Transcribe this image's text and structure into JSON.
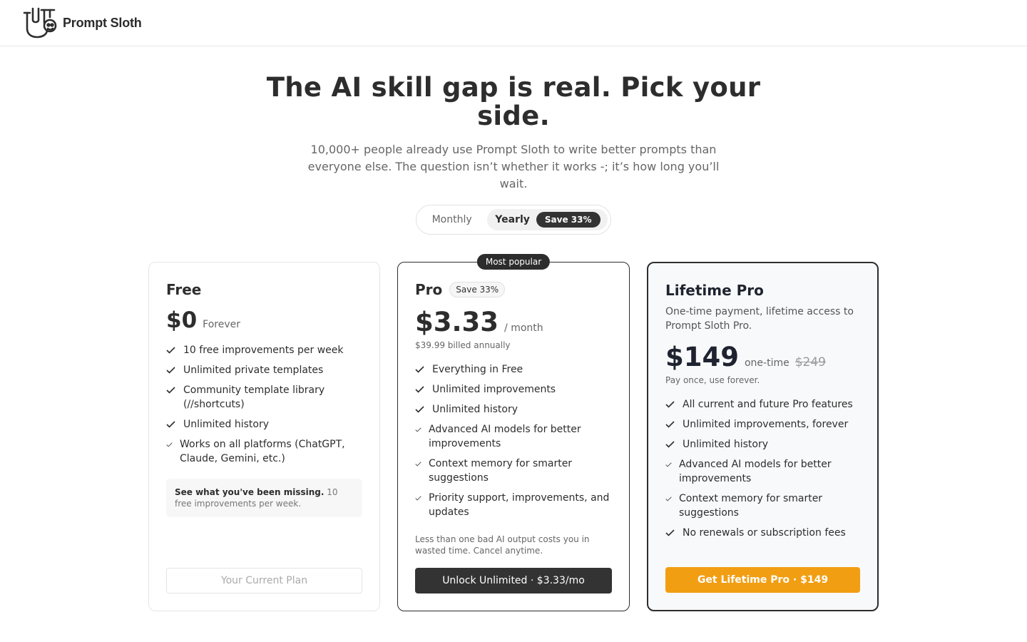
{
  "brand": {
    "name": "Prompt Sloth"
  },
  "hero": {
    "title": "The AI skill gap is real. Pick your side.",
    "subtitle": "10,000+ people already use Prompt Sloth to write better prompts than everyone else. The question isn’t whether it works -; it’s how long you’ll wait."
  },
  "billing_toggle": {
    "monthly_label": "Monthly",
    "yearly_label": "Yearly",
    "yearly_badge": "Save 33%",
    "selected": "Yearly"
  },
  "plans": {
    "free": {
      "name": "Free",
      "price": "$0",
      "price_suffix": "Forever",
      "features": [
        "10 free improvements per week",
        "Unlimited private templates",
        "Community template library (//shortcuts)",
        "Unlimited history",
        "Works on all platforms (ChatGPT, Claude, Gemini, etc.)"
      ],
      "missing_bold": "See what you've been missing.",
      "missing_text": "10 free improvements per week.",
      "button_label": "Your Current Plan"
    },
    "pro": {
      "badge_top": "Most popular",
      "name": "Pro",
      "name_tag": "Save 33%",
      "price": "$3.33",
      "price_suffix": "/ month",
      "billing_note": "$39.99 billed annually",
      "features": [
        "Everything in Free",
        "Unlimited improvements",
        "Unlimited history",
        "Advanced AI models for better improvements",
        "Context memory for smarter suggestions",
        "Priority support, improvements, and updates"
      ],
      "note": "Less than one bad AI output costs you in wasted time. Cancel anytime.",
      "button_label": "Unlock Unlimited · $3.33/mo"
    },
    "lifetime": {
      "name": "Lifetime Pro",
      "description": "One-time payment, lifetime access to Prompt Sloth Pro.",
      "price": "$149",
      "price_suffix": "one-time",
      "original_price": "$249",
      "billing_note": "Pay once, use forever.",
      "features": [
        "All current and future Pro features",
        "Unlimited improvements, forever",
        "Unlimited history",
        "Advanced AI models for better improvements",
        "Context memory for smarter suggestions",
        "No renewals or subscription fees"
      ],
      "button_label": "Get Lifetime Pro · $149"
    }
  },
  "colors": {
    "text_primary": "#2d2d2d",
    "accent_orange": "#f29e12",
    "dark_button": "#333333"
  },
  "icons": [
    "sloth-logo-icon",
    "check-icon"
  ]
}
